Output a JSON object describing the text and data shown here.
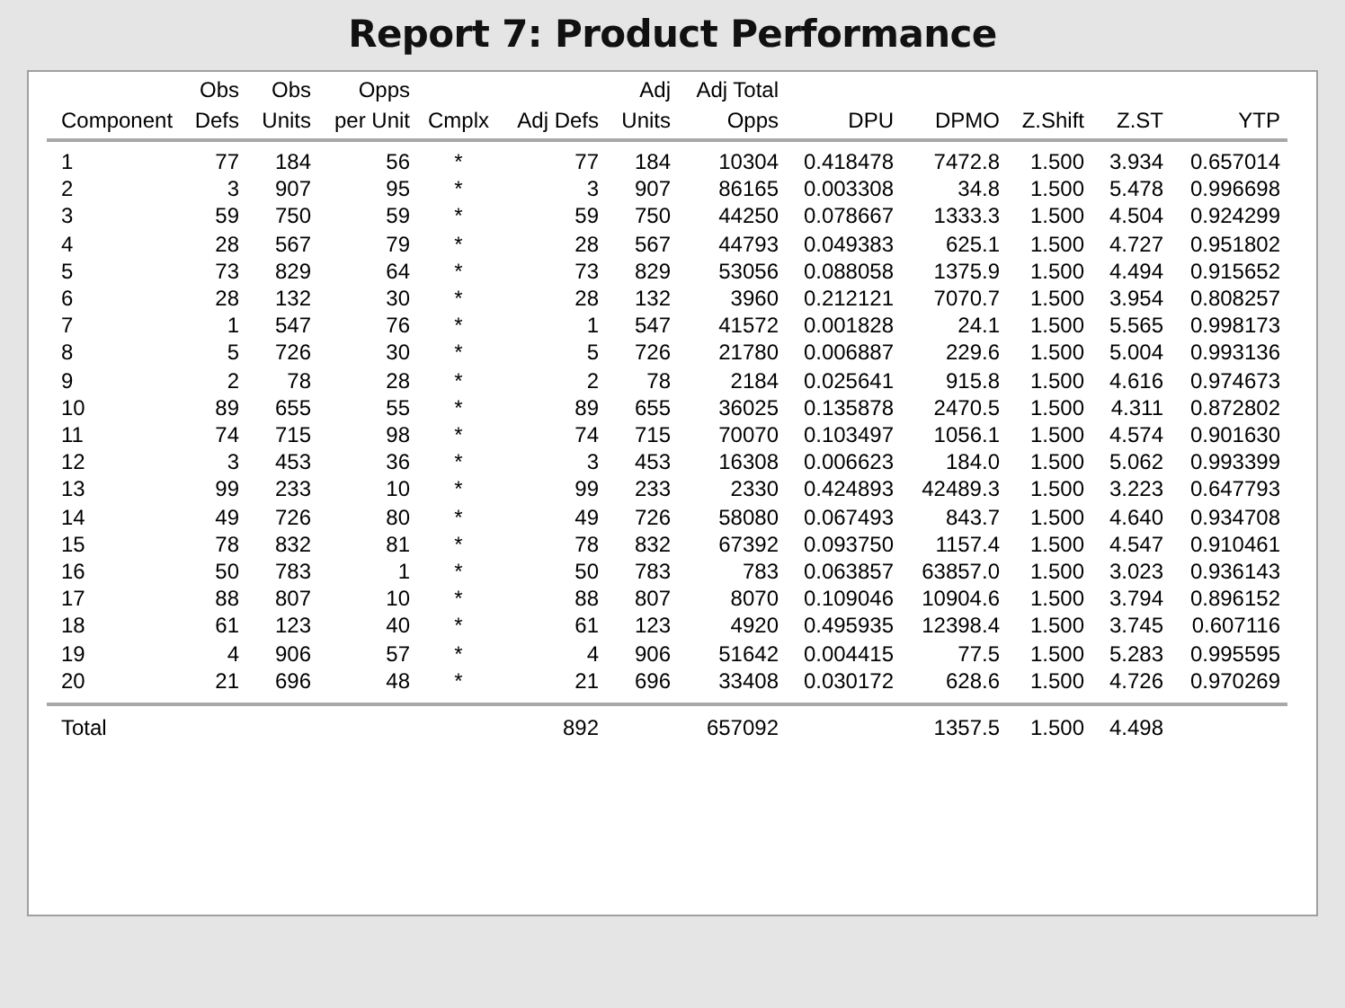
{
  "title": "Report 7: Product Performance",
  "table": {
    "columns": [
      "Component",
      "Obs\nDefs",
      "Obs\nUnits",
      "Opps\nper Unit",
      "Cmplx",
      "Adj Defs",
      "Adj\nUnits",
      "Adj Total\nOpps",
      "DPU",
      "DPMO",
      "Z.Shift",
      "Z.ST",
      "YTP"
    ],
    "rows": [
      [
        "1",
        "77",
        "184",
        "56",
        "*",
        "77",
        "184",
        "10304",
        "0.418478",
        "7472.8",
        "1.500",
        "3.934",
        "0.657014"
      ],
      [
        "2",
        "3",
        "907",
        "95",
        "*",
        "3",
        "907",
        "86165",
        "0.003308",
        "34.8",
        "1.500",
        "5.478",
        "0.996698"
      ],
      [
        "3",
        "59",
        "750",
        "59",
        "*",
        "59",
        "750",
        "44250",
        "0.078667",
        "1333.3",
        "1.500",
        "4.504",
        "0.924299"
      ],
      [
        "4",
        "28",
        "567",
        "79",
        "*",
        "28",
        "567",
        "44793",
        "0.049383",
        "625.1",
        "1.500",
        "4.727",
        "0.951802"
      ],
      [
        "5",
        "73",
        "829",
        "64",
        "*",
        "73",
        "829",
        "53056",
        "0.088058",
        "1375.9",
        "1.500",
        "4.494",
        "0.915652"
      ],
      [
        "6",
        "28",
        "132",
        "30",
        "*",
        "28",
        "132",
        "3960",
        "0.212121",
        "7070.7",
        "1.500",
        "3.954",
        "0.808257"
      ],
      [
        "7",
        "1",
        "547",
        "76",
        "*",
        "1",
        "547",
        "41572",
        "0.001828",
        "24.1",
        "1.500",
        "5.565",
        "0.998173"
      ],
      [
        "8",
        "5",
        "726",
        "30",
        "*",
        "5",
        "726",
        "21780",
        "0.006887",
        "229.6",
        "1.500",
        "5.004",
        "0.993136"
      ],
      [
        "9",
        "2",
        "78",
        "28",
        "*",
        "2",
        "78",
        "2184",
        "0.025641",
        "915.8",
        "1.500",
        "4.616",
        "0.974673"
      ],
      [
        "10",
        "89",
        "655",
        "55",
        "*",
        "89",
        "655",
        "36025",
        "0.135878",
        "2470.5",
        "1.500",
        "4.311",
        "0.872802"
      ],
      [
        "11",
        "74",
        "715",
        "98",
        "*",
        "74",
        "715",
        "70070",
        "0.103497",
        "1056.1",
        "1.500",
        "4.574",
        "0.901630"
      ],
      [
        "12",
        "3",
        "453",
        "36",
        "*",
        "3",
        "453",
        "16308",
        "0.006623",
        "184.0",
        "1.500",
        "5.062",
        "0.993399"
      ],
      [
        "13",
        "99",
        "233",
        "10",
        "*",
        "99",
        "233",
        "2330",
        "0.424893",
        "42489.3",
        "1.500",
        "3.223",
        "0.647793"
      ],
      [
        "14",
        "49",
        "726",
        "80",
        "*",
        "49",
        "726",
        "58080",
        "0.067493",
        "843.7",
        "1.500",
        "4.640",
        "0.934708"
      ],
      [
        "15",
        "78",
        "832",
        "81",
        "*",
        "78",
        "832",
        "67392",
        "0.093750",
        "1157.4",
        "1.500",
        "4.547",
        "0.910461"
      ],
      [
        "16",
        "50",
        "783",
        "1",
        "*",
        "50",
        "783",
        "783",
        "0.063857",
        "63857.0",
        "1.500",
        "3.023",
        "0.936143"
      ],
      [
        "17",
        "88",
        "807",
        "10",
        "*",
        "88",
        "807",
        "8070",
        "0.109046",
        "10904.6",
        "1.500",
        "3.794",
        "0.896152"
      ],
      [
        "18",
        "61",
        "123",
        "40",
        "*",
        "61",
        "123",
        "4920",
        "0.495935",
        "12398.4",
        "1.500",
        "3.745",
        "0.607116"
      ],
      [
        "19",
        "4",
        "906",
        "57",
        "*",
        "4",
        "906",
        "51642",
        "0.004415",
        "77.5",
        "1.500",
        "5.283",
        "0.995595"
      ],
      [
        "20",
        "21",
        "696",
        "48",
        "*",
        "21",
        "696",
        "33408",
        "0.030172",
        "628.6",
        "1.500",
        "4.726",
        "0.970269"
      ]
    ],
    "total": {
      "label": "Total",
      "adj_defs": "892",
      "adj_total_opps": "657092",
      "dpmo": "1357.5",
      "z_shift": "1.500",
      "z_st": "4.498"
    }
  }
}
